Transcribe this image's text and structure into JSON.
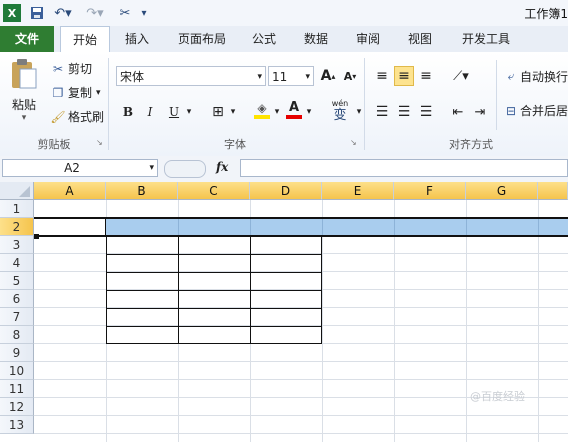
{
  "title": "工作簿1",
  "tabs": [
    "文件",
    "开始",
    "插入",
    "页面布局",
    "公式",
    "数据",
    "审阅",
    "视图",
    "开发工具"
  ],
  "clipboard": {
    "paste": "粘贴",
    "cut": "剪切",
    "copy": "复制",
    "format_painter": "格式刷",
    "label": "剪贴板"
  },
  "font": {
    "name": "宋体",
    "size": "11",
    "label": "字体",
    "bold": "B",
    "italic": "I",
    "underline": "U",
    "phonetic": "wén",
    "phonetic2": "变"
  },
  "alignment": {
    "wrap": "自动换行",
    "merge": "合并后居",
    "label": "对齐方式"
  },
  "name_box": "A2",
  "fx": "fx",
  "columns": [
    "A",
    "B",
    "C",
    "D",
    "E",
    "F",
    "G"
  ],
  "rows": [
    "1",
    "2",
    "3",
    "4",
    "5",
    "6",
    "7",
    "8",
    "9",
    "10",
    "11",
    "12",
    "13"
  ],
  "colors": {
    "file_tab": "#2f7d32",
    "selection": "#a9cdee",
    "header_selected": "#f5c44d"
  },
  "watermark": "@百度经验"
}
